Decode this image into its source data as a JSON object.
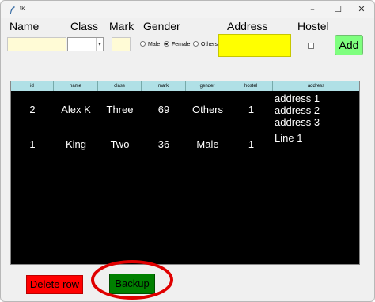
{
  "window": {
    "title": "tk",
    "controls": {
      "minimize": "–",
      "maximize": "☐",
      "close": "✕"
    }
  },
  "form": {
    "labels": {
      "name": "Name",
      "class": "Class",
      "mark": "Mark",
      "gender": "Gender",
      "address": "Address",
      "hostel": "Hostel"
    },
    "name_value": "",
    "class_value": "",
    "mark_value": "",
    "gender_options": [
      {
        "label": "Male",
        "selected": false
      },
      {
        "label": "Female",
        "selected": true
      },
      {
        "label": "Others",
        "selected": false
      }
    ],
    "address_value": "",
    "hostel_checked": false,
    "add_label": "Add"
  },
  "table": {
    "columns": [
      "id",
      "name",
      "class",
      "mark",
      "gender",
      "hostel",
      "address"
    ],
    "rows": [
      {
        "id": "2",
        "name": "Alex K",
        "class": "Three",
        "mark": "69",
        "gender": "Others",
        "hostel": "1",
        "address": [
          "address 1",
          "address 2",
          "address 3"
        ]
      },
      {
        "id": "1",
        "name": "King",
        "class": "Two",
        "mark": "36",
        "gender": "Male",
        "hostel": "1",
        "address": [
          "Line 1"
        ]
      }
    ]
  },
  "actions": {
    "delete_label": "Delete row",
    "backup_label": "Backup"
  },
  "colors": {
    "add_button": "#7fff7f",
    "delete_button": "#ff0000",
    "backup_button": "#008000",
    "address_field": "#ffff00",
    "table_header": "#b0e0e6",
    "highlight_circle": "#e00000"
  }
}
